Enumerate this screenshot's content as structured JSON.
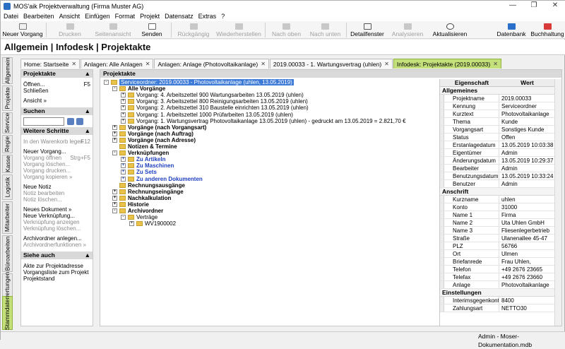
{
  "window": {
    "title": "MOS'aik Projektverwaltung (Firma Muster AG)"
  },
  "menu": [
    "Datei",
    "Bearbeiten",
    "Ansicht",
    "Einfügen",
    "Format",
    "Projekt",
    "Datensatz",
    "Extras",
    "?"
  ],
  "toolbar": {
    "neu": "Neuer Vorgang",
    "drucken": "Drucken",
    "seitenansicht": "Seitenansicht",
    "senden": "Senden",
    "rueck": "Rückgängig",
    "wieder": "Wiederherstellen",
    "oben": "Nach oben",
    "unten": "Nach unten",
    "detail": "Detailfenster",
    "analys": "Analysieren",
    "aktual": "Aktualisieren",
    "datenbank": "Datenbank",
    "buchhaltung": "Buchhaltung"
  },
  "header": {
    "title": "Allgemein | Infodesk | Projektakte"
  },
  "vtabs": [
    "Allgemein",
    "Projekte",
    "Service",
    "Regie",
    "Kasse",
    "Logistik",
    "Mitarbeiter",
    "Büroarbeiten",
    "Auswertungen",
    "Stammdaten"
  ],
  "doctabs": [
    "Home: Startseite",
    "Anlagen: Alle Anlagen",
    "Anlagen: Anlage (Photovoltaikanlage)",
    "2019.00033 - 1. Wartungsvertrag (uhlen)",
    "Infodesk: Projektakte (2019.00033)"
  ],
  "left": {
    "projektakte_title": "Projektakte",
    "oeffnen": "Öffnen...",
    "oeffnen_key": "F5",
    "schliessen": "Schließen",
    "ansicht": "Ansicht »",
    "suchen_title": "Suchen",
    "weitere_title": "Weitere Schritte",
    "warenkorb": "In den Warenkorb legen",
    "warenkorb_key": "F12",
    "neuer_vorgang": "Neuer Vorgang...",
    "vorgang_oeffnen": "Vorgang öffnen",
    "vorgang_oeffnen_key": "Strg+F5",
    "vorgang_loeschen": "Vorgang löschen...",
    "vorgang_drucken": "Vorgang drucken...",
    "vorgang_kopieren": "Vorgang kopieren »",
    "neue_notiz": "Neue Notiz",
    "notiz_bearbeiten": "Notiz bearbeiten",
    "notiz_loeschen": "Notiz löschen...",
    "neues_dokument": "Neues Dokument »",
    "neue_verknuepfung": "Neue Verknüpfung...",
    "verkn_anzeigen": "Verknüpfung anzeigen",
    "verkn_loeschen": "Verknüpfung löschen...",
    "archivordner_anlegen": "Archivordner anlegen...",
    "archivordner_funktionen": "Archivordnerfunktionen »",
    "siehe_title": "Siehe auch",
    "siehe1": "Akte zur Projektadresse",
    "siehe2": "Vorgangsliste zum Projekt",
    "siehe3": "Projektstand"
  },
  "main": {
    "title": "Projektakte"
  },
  "tree": [
    {
      "text": "Serviceordner: 2019.00033 - Photovoltaikanlage (uhlen, 13.05.2019)",
      "level": 0,
      "style": "sel",
      "exp": "-",
      "folder": true
    },
    {
      "text": "Alle Vorgänge",
      "level": 1,
      "style": "bold",
      "exp": "-",
      "folder": true
    },
    {
      "text": "Vorgang: 4. Arbeitszettel 900 Wartungsarbeiten 13.05.2019 (uhlen)",
      "level": 2,
      "style": "",
      "exp": "+",
      "folder": true
    },
    {
      "text": "Vorgang: 3. Arbeitszettel 800 Reinigungsarbeiten 13.05.2019 (uhlen)",
      "level": 2,
      "style": "",
      "exp": "+",
      "folder": true
    },
    {
      "text": "Vorgang: 2. Arbeitszettel 310 Baustelle einrichten 13.05.2019 (uhlen)",
      "level": 2,
      "style": "",
      "exp": "+",
      "folder": true
    },
    {
      "text": "Vorgang: 1. Arbeitszettel 1000 Prüfarbeiten 13.05.2019 (uhlen)",
      "level": 2,
      "style": "",
      "exp": "+",
      "folder": true
    },
    {
      "text": "Vorgang: 1. Wartungsvertrag Photovoltaikanlage 13.05.2019 (uhlen) - gedruckt am 13.05.2019 = 2.821,70 €",
      "level": 2,
      "style": "",
      "exp": "+",
      "folder": true
    },
    {
      "text": "Vorgänge (nach Vorgangsart)",
      "level": 1,
      "style": "bold",
      "exp": "+",
      "folder": true
    },
    {
      "text": "Vorgänge (nach Auftrag)",
      "level": 1,
      "style": "bold",
      "exp": "+",
      "folder": true
    },
    {
      "text": "Vorgänge (nach Adresse)",
      "level": 1,
      "style": "bold",
      "exp": "+",
      "folder": true
    },
    {
      "text": "Notizen & Termine",
      "level": 1,
      "style": "bold",
      "exp": "",
      "folder": true
    },
    {
      "text": "Verknüpfungen",
      "level": 1,
      "style": "bold",
      "exp": "-",
      "folder": true
    },
    {
      "text": "Zu Artikeln",
      "level": 2,
      "style": "blue",
      "exp": "+",
      "folder": true
    },
    {
      "text": "Zu Maschinen",
      "level": 2,
      "style": "blue",
      "exp": "+",
      "folder": true
    },
    {
      "text": "Zu Sets",
      "level": 2,
      "style": "blue",
      "exp": "+",
      "folder": true
    },
    {
      "text": "Zu anderen Dokumenten",
      "level": 2,
      "style": "blue",
      "exp": "+",
      "folder": true
    },
    {
      "text": "Rechnungsausgänge",
      "level": 1,
      "style": "bold",
      "exp": "",
      "folder": true
    },
    {
      "text": "Rechnungseingänge",
      "level": 1,
      "style": "bold",
      "exp": "+",
      "folder": true
    },
    {
      "text": "Nachkalkulation",
      "level": 1,
      "style": "bold",
      "exp": "+",
      "folder": true
    },
    {
      "text": "Historie",
      "level": 1,
      "style": "bold",
      "exp": "+",
      "folder": true
    },
    {
      "text": "Archivordner",
      "level": 1,
      "style": "bold",
      "exp": "-",
      "folder": true
    },
    {
      "text": "Verträge",
      "level": 2,
      "style": "",
      "exp": "-",
      "folder": true
    },
    {
      "text": "WV1900002",
      "level": 3,
      "style": "",
      "exp": "+",
      "folder": true
    }
  ],
  "props": {
    "col_name": "Eigenschaft",
    "col_value": "Wert",
    "sections": [
      {
        "title": "Allgemeines",
        "rows": [
          [
            "Projektname",
            "2019.00033"
          ],
          [
            "Kennung",
            "Serviceordner"
          ],
          [
            "Kurztext",
            "Photovoltaikanlage"
          ],
          [
            "Thema",
            "Kunde"
          ],
          [
            "Vorgangsart",
            "Sonstiges Kunde"
          ],
          [
            "Status",
            "Offen"
          ],
          [
            "Erstanlagedatum",
            "13.05.2019 10:03:38"
          ],
          [
            "Eigentümer",
            "Admin"
          ],
          [
            "Änderungsdatum",
            "13.05.2019 10:29:37"
          ],
          [
            "Bearbeiter",
            "Admin"
          ],
          [
            "Benutzungsdatum",
            "13.05.2019 10:33:24"
          ],
          [
            "Benutzer",
            "Admin"
          ]
        ]
      },
      {
        "title": "Anschrift",
        "rows": [
          [
            "Kurzname",
            "uhlen"
          ],
          [
            "Konto",
            "31000"
          ],
          [
            "Name 1",
            "Firma"
          ],
          [
            "Name 2",
            "Uta Uhlen GmbH"
          ],
          [
            "Name 3",
            "Fliesenlegerbetrieb"
          ],
          [
            "Straße",
            "Ulanenallee 45-47"
          ],
          [
            "PLZ",
            "56766"
          ],
          [
            "Ort",
            "Ulmen"
          ],
          [
            "Briefanrede",
            " Frau Uhlen,"
          ],
          [
            "Telefon",
            "+49 2676 23665"
          ],
          [
            "Telefax",
            "+49 2676 23660"
          ],
          [
            "Anlage",
            "Photovoltaikanlage"
          ]
        ]
      },
      {
        "title": "Einstellungen",
        "rows": [
          [
            "Interimsgegenkonto",
            "8400"
          ],
          [
            "Zahlungsart",
            "NETTO30"
          ]
        ]
      }
    ]
  },
  "status": {
    "text": "Admin - Moser-Dokumentation.mdb"
  }
}
